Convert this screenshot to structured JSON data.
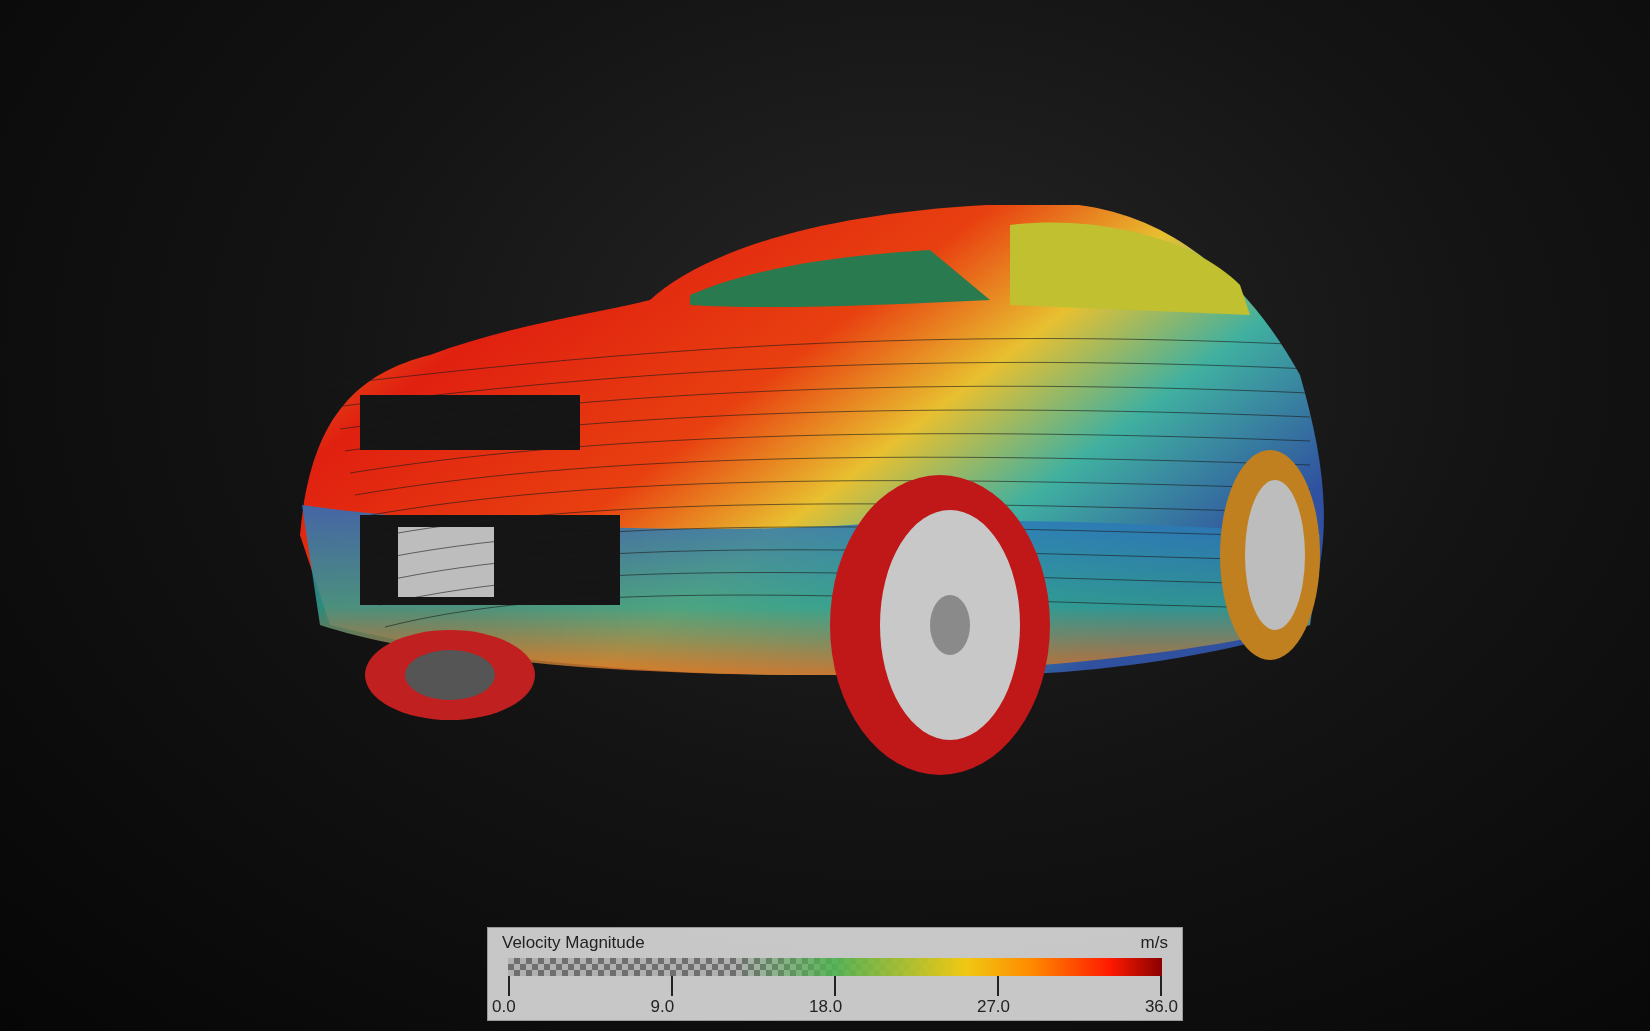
{
  "legend": {
    "title": "Velocity Magnitude",
    "unit": "m/s",
    "ticks": [
      "0.0",
      "9.0",
      "18.0",
      "27.0",
      "36.0"
    ]
  }
}
